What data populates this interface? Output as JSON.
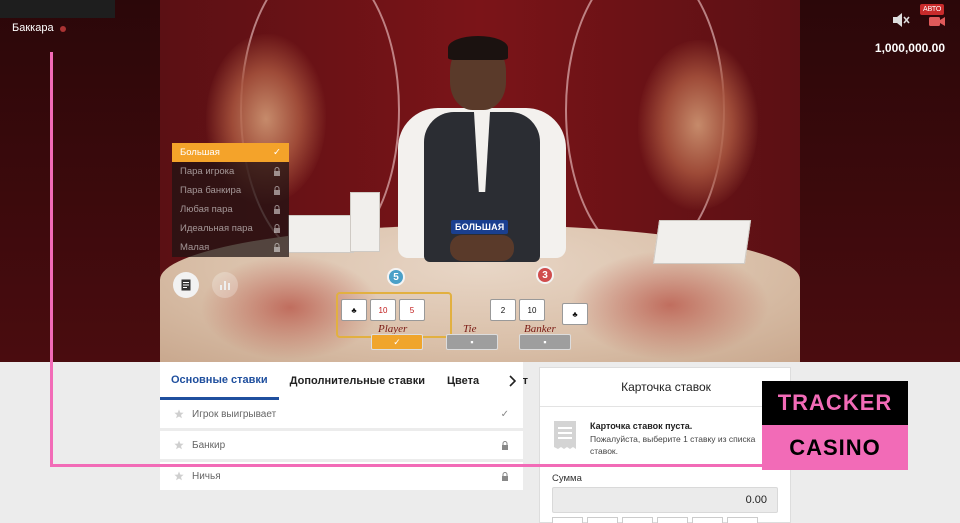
{
  "header": {
    "title": "Баккара",
    "auto_badge": "АВТО",
    "balance": "1,000,000.00"
  },
  "dealer_overlay": {
    "big_label": "БОЛЬШАЯ",
    "player_score": "5",
    "banker_score": "3",
    "player_label": "Player",
    "tie_label": "Tie",
    "banker_label": "Banker",
    "player_cards": [
      {
        "rank": "♣",
        "red": false
      },
      {
        "rank": "10",
        "red": true
      },
      {
        "rank": "5",
        "red": true
      }
    ],
    "banker_cards": [
      {
        "rank": "2",
        "red": false
      },
      {
        "rank": "10",
        "red": false
      },
      {
        "rank": "♣",
        "red": false
      }
    ]
  },
  "side_bets": {
    "items": [
      {
        "label": "Большая",
        "active": true
      },
      {
        "label": "Пара игрока",
        "active": false
      },
      {
        "label": "Пара банкира",
        "active": false
      },
      {
        "label": "Любая пара",
        "active": false
      },
      {
        "label": "Идеальная пара",
        "active": false
      },
      {
        "label": "Малая",
        "active": false
      }
    ]
  },
  "tabs": [
    {
      "label": "Основные ставки",
      "active": true
    },
    {
      "label": "Дополнительные ставки",
      "active": false
    },
    {
      "label": "Цвета",
      "active": false
    },
    {
      "label": "Маст",
      "active": false
    }
  ],
  "main_bets": [
    {
      "label": "Игрок выигрывает",
      "status": "check"
    },
    {
      "label": "Банкир",
      "status": "lock"
    },
    {
      "label": "Ничья",
      "status": "lock"
    }
  ],
  "bet_slip": {
    "title": "Карточка ставок",
    "empty_title": "Карточка ставок пуста.",
    "empty_desc": "Пожалуйста, выберите 1 ставку из списка ставок.",
    "sum_label": "Сумма",
    "sum_value": "0.00"
  },
  "watermark": {
    "line1": "TRACKER",
    "line2": "CASINO"
  },
  "colors": {
    "accent": "#1f4f9e",
    "active_bet": "#f4a32a",
    "watermark_pink": "#f26bb7"
  }
}
